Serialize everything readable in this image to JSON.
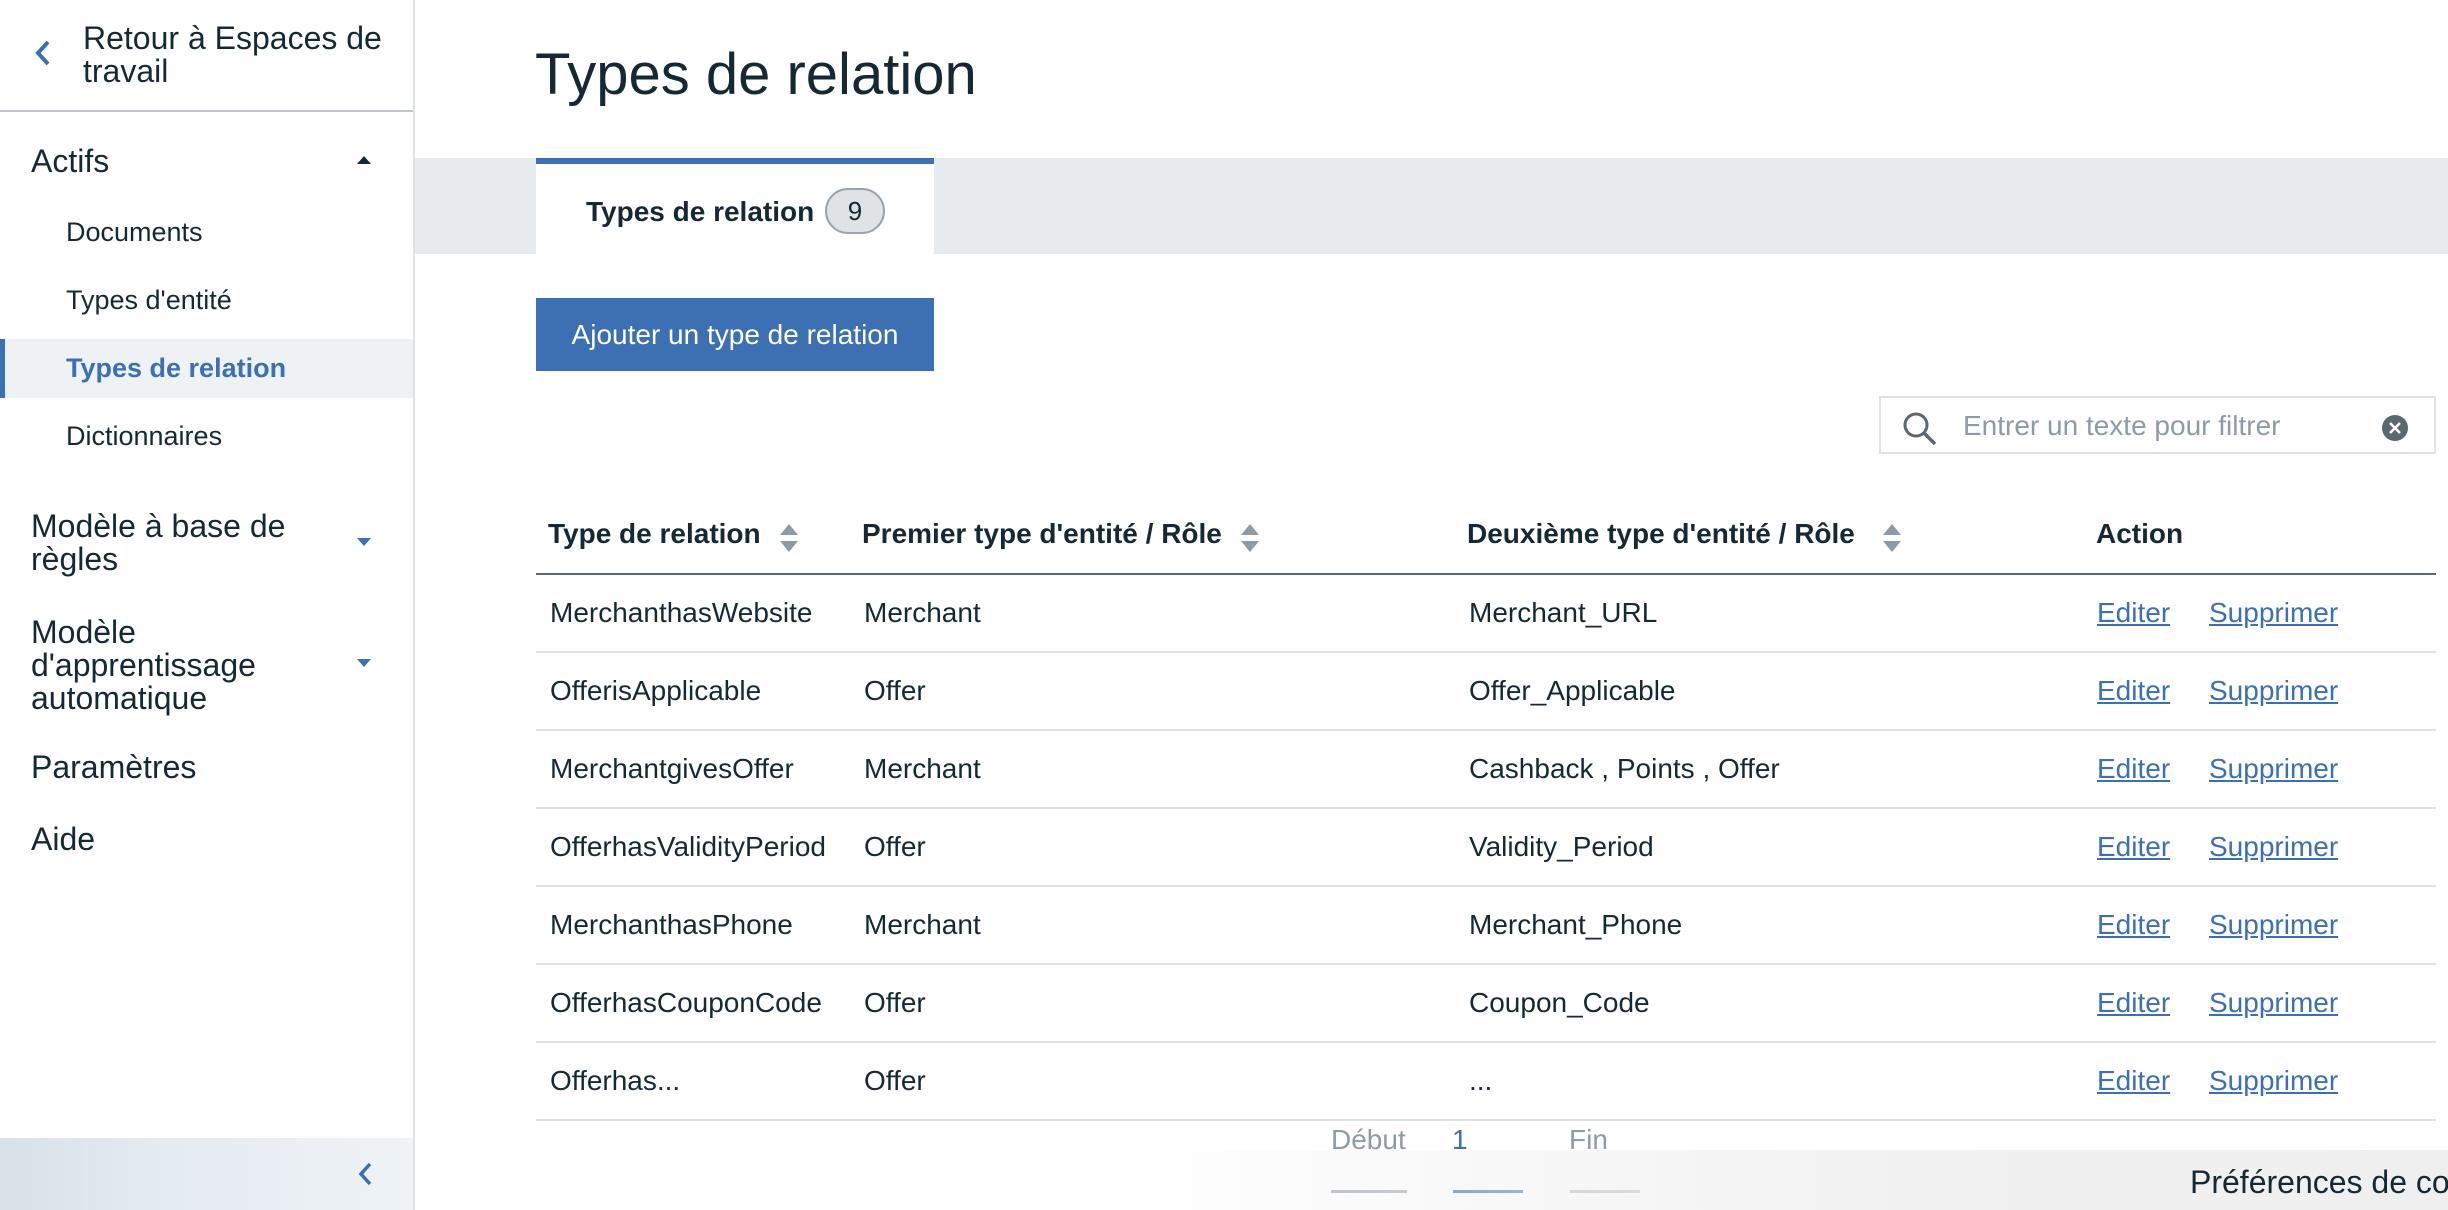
{
  "sidebar": {
    "back_label": "Retour à Espaces de travail",
    "sections": {
      "actifs": "Actifs",
      "rules_model": "Modèle à base de règles",
      "ml_model": "Modèle d'apprentissage automatique",
      "settings": "Paramètres",
      "help": "Aide"
    },
    "items": [
      {
        "label": "Documents"
      },
      {
        "label": "Types d'entité"
      },
      {
        "label": "Types de relation"
      },
      {
        "label": "Dictionnaires"
      }
    ],
    "active_item": "Types de relation"
  },
  "page": {
    "title": "Types de relation"
  },
  "tab": {
    "label": "Types de relation",
    "count": "9"
  },
  "add_button": "Ajouter un type de relation",
  "search": {
    "placeholder": "Entrer un texte pour filtrer",
    "value": ""
  },
  "table": {
    "headers": [
      "Type de relation",
      "Premier type d'entité / Rôle",
      "Deuxième type d'entité / Rôle",
      "Action"
    ],
    "rows": [
      {
        "type": "MerchanthasWebsite",
        "first": "Merchant",
        "second": "Merchant_URL"
      },
      {
        "type": "OfferisApplicable",
        "first": "Offer",
        "second": "Offer_Applicable"
      },
      {
        "type": "MerchantgivesOffer",
        "first": "Merchant",
        "second": "Cashback , Points , Offer"
      },
      {
        "type": "OfferhasValidityPeriod",
        "first": "Offer",
        "second": "Validity_Period"
      },
      {
        "type": "MerchanthasPhone",
        "first": "Merchant",
        "second": "Merchant_Phone"
      },
      {
        "type": "OfferhasCouponCode",
        "first": "Offer",
        "second": "Coupon_Code"
      },
      {
        "type": "Offerhas...",
        "first": "Offer",
        "second": "..."
      }
    ],
    "edit_label": "Editer",
    "delete_label": "Supprimer"
  },
  "pagination": {
    "first": "Début",
    "current": "1",
    "last": "Fin"
  },
  "cookie_prefs": "Préférences de co",
  "colors": {
    "accent": "#3d70b2",
    "text": "#152935",
    "muted": "#8c9ba5"
  }
}
